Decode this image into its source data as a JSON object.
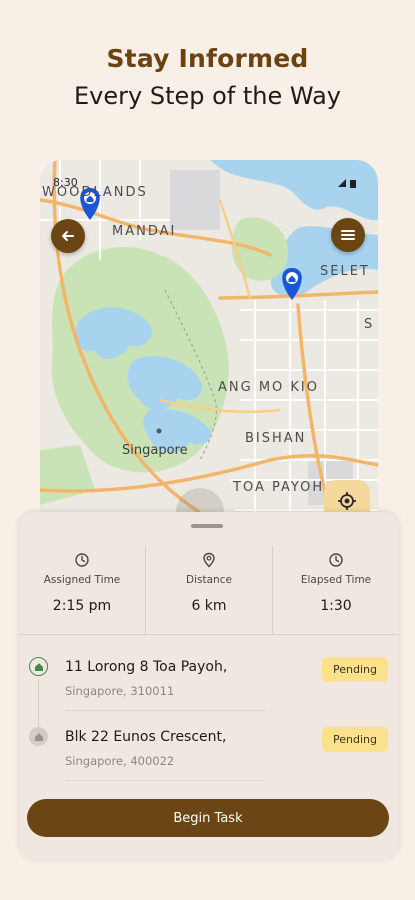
{
  "header": {
    "title": "Stay Informed",
    "subtitle": "Every Step of the Way"
  },
  "status_bar": {
    "time": "8:30"
  },
  "map": {
    "labels": {
      "woodlands": "WOODLANDS",
      "mandai": "MANDAI",
      "seletar": "SELET",
      "ang_mo_kio": "ANG MO KIO",
      "bishan": "BISHAN",
      "toa_payoh": "TOA PAYOH",
      "singapore": "Singapore",
      "edge_s": "S"
    },
    "colors": {
      "marker": "#1a56d6",
      "water": "#a8d3ee",
      "park": "#c9e3b6",
      "road": "#f3b56a"
    }
  },
  "stats": [
    {
      "icon": "clock-icon",
      "label": "Assigned Time",
      "value": "2:15 pm"
    },
    {
      "icon": "location-pin-icon",
      "label": "Distance",
      "value": "6 km"
    },
    {
      "icon": "clock-icon",
      "label": "Elapsed Time",
      "value": "1:30"
    }
  ],
  "stops": [
    {
      "title": "11 Lorong 8 Toa Payoh,",
      "subtitle": "Singapore, 310011",
      "status": "Pending"
    },
    {
      "title": "Blk 22 Eunos Crescent,",
      "subtitle": "Singapore, 400022",
      "status": "Pending"
    }
  ],
  "action": {
    "begin_label": "Begin Task"
  },
  "colors": {
    "brand": "#6b4614",
    "badge": "#fbe18b",
    "background": "#f8efe6"
  }
}
